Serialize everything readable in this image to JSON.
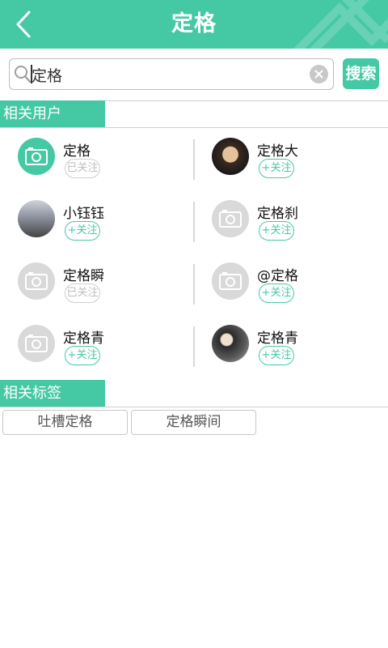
{
  "header": {
    "title": "定格"
  },
  "search": {
    "query": "定格",
    "button_label": "搜索"
  },
  "sections": {
    "users_title": "相关用户",
    "tags_title": "相关标签"
  },
  "users": [
    {
      "name": "定格",
      "follow_label": "已关注",
      "followed": true,
      "avatar": "camera-icon-green"
    },
    {
      "name": "定格大",
      "follow_label": "+关注",
      "followed": false,
      "avatar": "photo"
    },
    {
      "name": "小钰钰",
      "follow_label": "+关注",
      "followed": false,
      "avatar": "photo"
    },
    {
      "name": "定格刹",
      "follow_label": "+关注",
      "followed": false,
      "avatar": "camera-icon-grey"
    },
    {
      "name": "定格瞬",
      "follow_label": "已关注",
      "followed": true,
      "avatar": "camera-icon-grey"
    },
    {
      "name": "@定格",
      "follow_label": "+关注",
      "followed": false,
      "avatar": "camera-icon-grey"
    },
    {
      "name": "定格青",
      "follow_label": "+关注",
      "followed": false,
      "avatar": "camera-icon-grey"
    },
    {
      "name": "定格青",
      "follow_label": "+关注",
      "followed": false,
      "avatar": "photo"
    }
  ],
  "tags": [
    "吐槽定格",
    "定格瞬间"
  ],
  "colors": {
    "accent": "#45c9a4",
    "divider": "#cfcfcf",
    "followed_text": "#bdbdbd"
  }
}
